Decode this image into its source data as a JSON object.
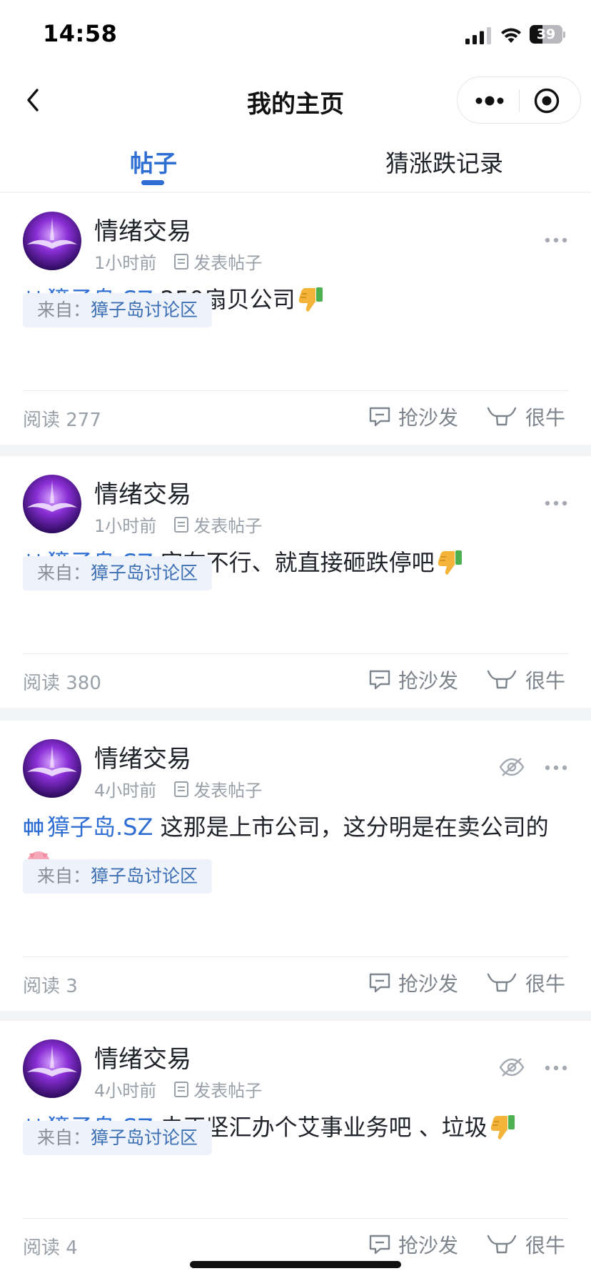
{
  "status_bar": {
    "time": "14:58",
    "battery": "39",
    "battery_level": 0.39
  },
  "nav": {
    "title": "我的主页",
    "back_icon": "chevron-left-icon",
    "more_icon": "more-dots-icon",
    "close_icon": "target-icon"
  },
  "tabs": [
    {
      "label": "帖子",
      "active": true
    },
    {
      "label": "猜涨跌记录",
      "active": false
    }
  ],
  "posts": [
    {
      "author": "情绪交易",
      "time": "1小时前",
      "type": "发表帖子",
      "stock": "獐子岛.SZ",
      "text": "250扇贝公司",
      "emoji": "thumbs-down",
      "source_label": "来自：",
      "source_name": "獐子岛讨论区",
      "reads": "阅读 277",
      "comment_label": "抢沙发",
      "like_label": "很牛",
      "hidden_icon": false
    },
    {
      "author": "情绪交易",
      "time": "1小时前",
      "type": "发表帖子",
      "stock": "獐子岛.SZ",
      "text": "实在不行、就直接砸跌停吧",
      "emoji": "thumbs-down",
      "source_label": "来自：",
      "source_name": "獐子岛讨论区",
      "reads": "阅读 380",
      "comment_label": "抢沙发",
      "like_label": "很牛",
      "hidden_icon": false
    },
    {
      "author": "情绪交易",
      "time": "4小时前",
      "type": "发表帖子",
      "stock": "獐子岛.SZ",
      "text": "这那是上市公司，这分明是在卖公司的",
      "emoji": "pig",
      "source_label": "来自：",
      "source_name": "獐子岛讨论区",
      "reads": "阅读 3",
      "comment_label": "抢沙发",
      "like_label": "很牛",
      "hidden_icon": true
    },
    {
      "author": "情绪交易",
      "time": "4小时前",
      "type": "发表帖子",
      "stock": "獐子岛.SZ",
      "text": "去正坚汇办个艾事业务吧 、垃圾",
      "emoji": "thumbs-down",
      "source_label": "来自：",
      "source_name": "獐子岛讨论区",
      "reads": "阅读 4",
      "comment_label": "抢沙发",
      "like_label": "很牛",
      "hidden_icon": true
    }
  ],
  "colors": {
    "accent": "#2f6fd4",
    "source_bg": "#eef3fb",
    "muted": "#9aa0a8",
    "page_bg": "#f2f3f5"
  }
}
